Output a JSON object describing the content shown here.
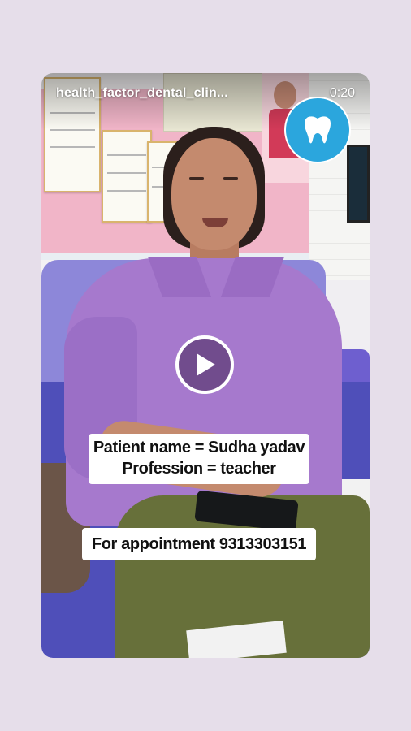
{
  "header": {
    "account_name": "health_factor_dental_clin...",
    "timestamp": "0:20"
  },
  "video": {
    "play_icon": "play-icon",
    "logo_icon": "tooth-icon"
  },
  "captions": {
    "line1": "Patient name = Sudha yadav",
    "line2": "Profession = teacher",
    "line3": "For appointment 9313303151"
  },
  "colors": {
    "page_background": "#e6deea",
    "logo_blue": "#2ba6dd",
    "caption_background": "#ffffff"
  }
}
